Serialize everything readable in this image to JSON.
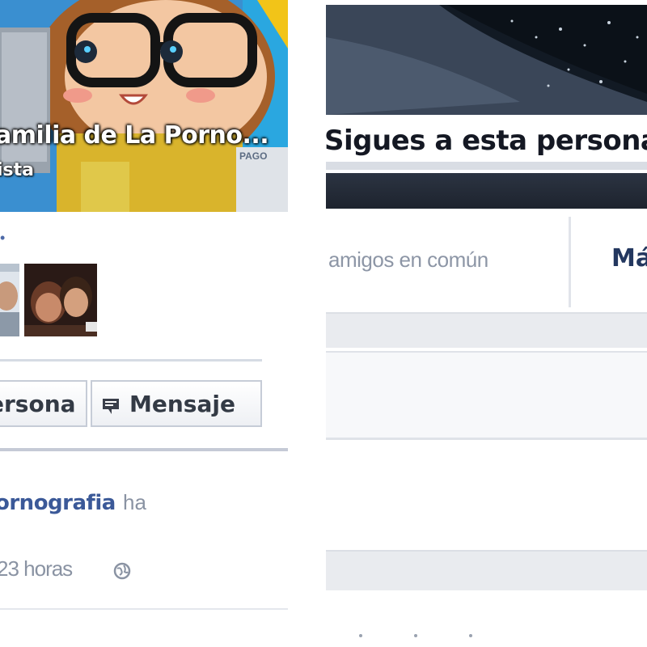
{
  "left_card": {
    "cover_title": "amilia de La Porno...",
    "cover_subtitle": "ista",
    "cover_side_label": "PAGO",
    "link_fragment": "•",
    "follow_button_label": "ersona",
    "message_button_label": "Mensaje",
    "message_icon": "message-bubble-icon",
    "story": {
      "link_text": "ornografia",
      "rest_text": "ha",
      "time_text": "23 horas",
      "privacy_icon": "globe-icon"
    }
  },
  "right_card": {
    "cover_title": "Sigues a esta persona",
    "mutual_friends_text": "amigos en común",
    "more_link": "Más"
  },
  "colors": {
    "link_blue": "#3b5998",
    "muted_text": "#8a93a3",
    "border": "#c6ccd7",
    "panel_bg": "#e9ebef"
  }
}
